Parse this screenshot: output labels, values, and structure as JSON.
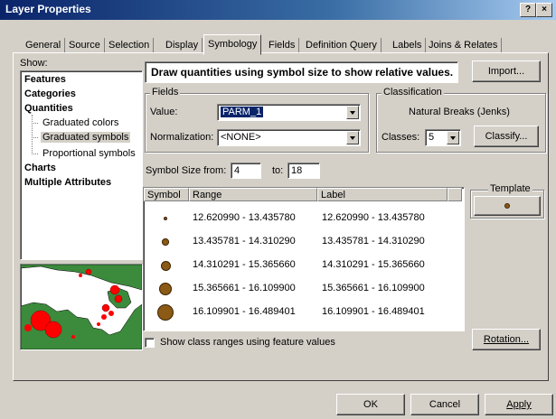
{
  "window": {
    "title": "Layer Properties",
    "help_label": "?",
    "close_label": "×"
  },
  "tabs": [
    "General",
    "Source",
    "Selection",
    "Display",
    "Symbology",
    "Fields",
    "Definition Query",
    "Labels",
    "Joins & Relates"
  ],
  "active_tab": "Symbology",
  "show": {
    "label": "Show:",
    "items": {
      "features": "Features",
      "categories": "Categories",
      "quantities": "Quantities",
      "graduated_colors": "Graduated colors",
      "graduated_symbols": "Graduated symbols",
      "proportional_symbols": "Proportional symbols",
      "charts": "Charts",
      "multiple_attributes": "Multiple Attributes"
    },
    "selected": "Graduated symbols"
  },
  "header_text": "Draw quantities using symbol size to show relative values.",
  "import_label": "Import...",
  "fields": {
    "group_label": "Fields",
    "value_label": "Value:",
    "value": "PARM_1",
    "normalization_label": "Normalization:",
    "normalization_value": "<NONE>"
  },
  "classification": {
    "group_label": "Classification",
    "method": "Natural Breaks (Jenks)",
    "classes_label": "Classes:",
    "classes_value": "5",
    "classify_label": "Classify..."
  },
  "symbol_size": {
    "from_label": "Symbol Size from:",
    "from_value": "4",
    "to_label": "to:",
    "to_value": "18"
  },
  "table": {
    "headers": [
      "Symbol",
      "Range",
      "Label"
    ],
    "rows": [
      {
        "range": "12.620990 - 13.435780",
        "label": "12.620990 - 13.435780",
        "size": 4
      },
      {
        "range": "13.435781 - 14.310290",
        "label": "13.435781 - 14.310290",
        "size": 7.5
      },
      {
        "range": "14.310291 - 15.365660",
        "label": "14.310291 - 15.365660",
        "size": 11
      },
      {
        "range": "15.365661 - 16.109900",
        "label": "15.365661 - 16.109900",
        "size": 14.5
      },
      {
        "range": "16.109901 - 16.489401",
        "label": "16.109901 - 16.489401",
        "size": 18
      }
    ]
  },
  "template_label": "Template",
  "rotation_label": "Rotation...",
  "show_class_ranges_label": "Show class ranges using feature values",
  "buttons": {
    "ok": "OK",
    "cancel": "Cancel",
    "apply": "Apply"
  },
  "colors": {
    "symbol_fill": "#8b5a14",
    "map_sea": "#ffffff",
    "map_land": "#3c8a3c",
    "map_points": "#ff0000"
  }
}
